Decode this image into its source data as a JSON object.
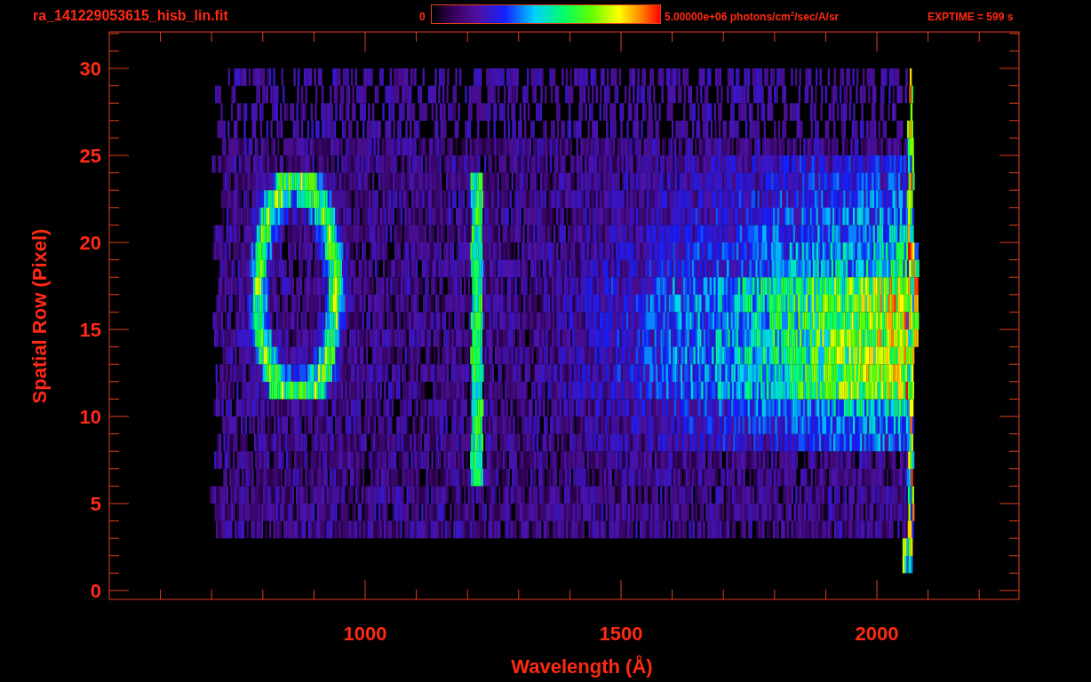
{
  "plot": {
    "title": "ra_141229053615_hisb_lin.fit",
    "colorbar": {
      "min_label": "0",
      "max_label": "5.00000e+06 photons/cm$^{2}$/sec/A/sr"
    },
    "exposure": "EXPTIME = 599 s",
    "y_axis": {
      "label": "Spatial Row (Pixel)",
      "ticks": [
        "30",
        "25",
        "20",
        "15",
        "10",
        "5",
        "0"
      ]
    },
    "x_axis": {
      "label": "Wavelength (Å)",
      "ticks": [
        "1000",
        "1500",
        "2000"
      ]
    }
  }
}
